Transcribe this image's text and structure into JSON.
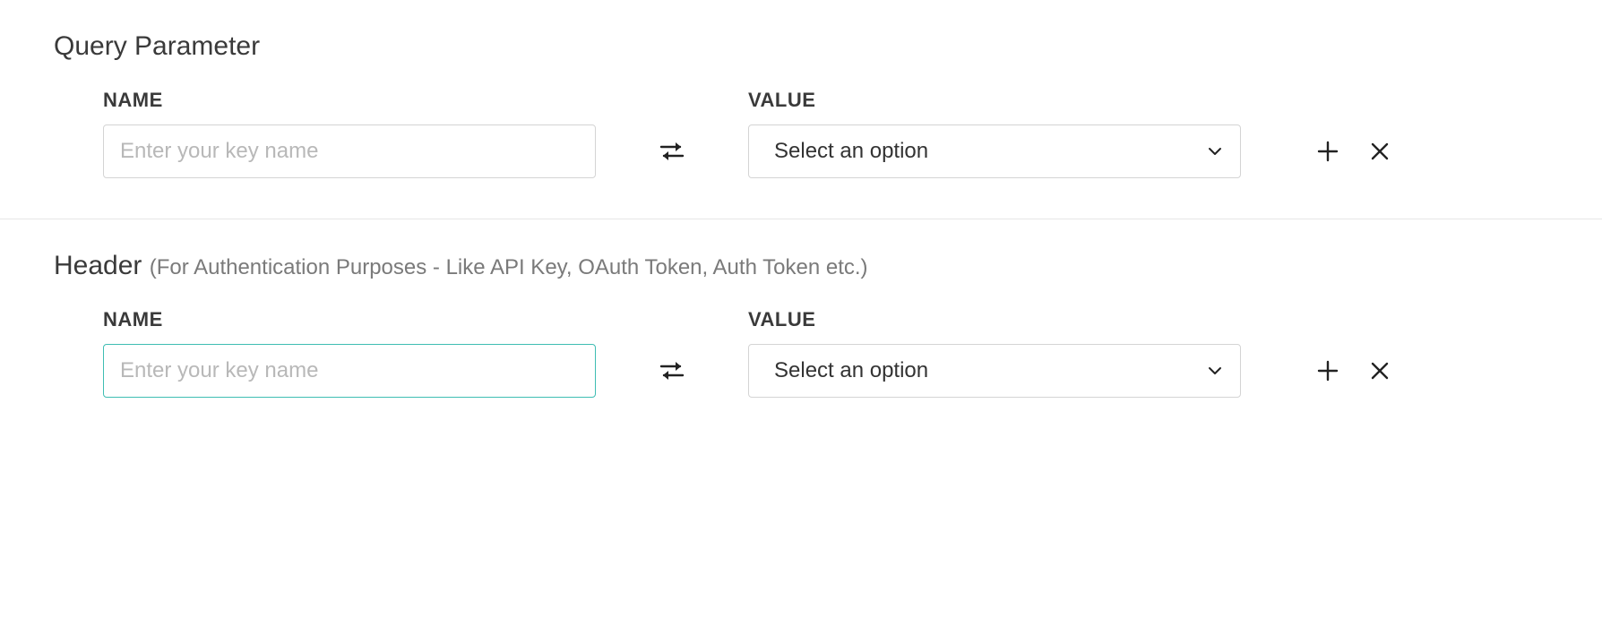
{
  "sections": {
    "query": {
      "title": "Query Parameter",
      "labels": {
        "name": "NAME",
        "value": "VALUE"
      },
      "row": {
        "name_placeholder": "Enter your key name",
        "value_selected": "Select an option"
      }
    },
    "header": {
      "title": "Header",
      "subtitle": "(For Authentication Purposes - Like API Key, OAuth Token, Auth Token etc.)",
      "labels": {
        "name": "NAME",
        "value": "VALUE"
      },
      "row": {
        "name_placeholder": "Enter your key name",
        "value_selected": "Select an option"
      }
    }
  }
}
